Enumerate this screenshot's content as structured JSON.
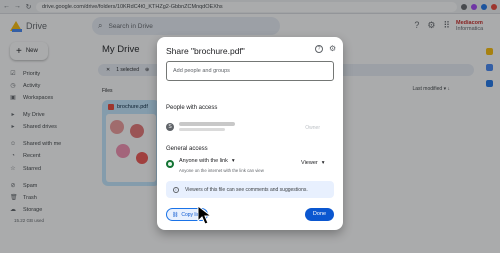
{
  "browser": {
    "url": "drive.google.com/drive/folders/10KRdC4t0_KTHZg2-GbbnZCMnqdOEXhs"
  },
  "header": {
    "app_name": "Drive",
    "search_placeholder": "Search in Drive",
    "brand_lines": [
      "Mediacom",
      "Informatica"
    ]
  },
  "sidebar": {
    "new_label": "New",
    "items": [
      {
        "label": "Priority",
        "icon": "priority-icon"
      },
      {
        "label": "Activity",
        "icon": "activity-icon"
      },
      {
        "label": "Workspaces",
        "icon": "workspaces-icon"
      },
      {
        "label": "My Drive",
        "icon": "my-drive-icon"
      },
      {
        "label": "Shared drives",
        "icon": "shared-drives-icon"
      },
      {
        "label": "Shared with me",
        "icon": "shared-icon"
      },
      {
        "label": "Recent",
        "icon": "clock-icon"
      },
      {
        "label": "Starred",
        "icon": "star-icon"
      },
      {
        "label": "Spam",
        "icon": "spam-icon"
      },
      {
        "label": "Trash",
        "icon": "trash-icon"
      },
      {
        "label": "Storage",
        "icon": "cloud-icon"
      }
    ],
    "storage_used": "15.22 GB used"
  },
  "main": {
    "title": "My Drive",
    "selection": "1 selected",
    "files_label": "Files",
    "sort_label": "Last modified",
    "file_name": "brochure.pdf"
  },
  "dialog": {
    "title": "Share \"brochure.pdf\"",
    "add_people_placeholder": "Add people and groups",
    "people_heading": "People with access",
    "owner_avatar_letter": "S",
    "owner_role": "Owner",
    "general_access_heading": "General access",
    "access_option": "Anyone with the link",
    "access_description": "Anyone on the internet with the link can view",
    "role": "Viewer",
    "info_text": "Viewers of this file can see comments and suggestions.",
    "copy_link_label": "Copy link",
    "done_label": "Done"
  },
  "colors": {
    "primary_blue": "#0b57d0",
    "selection_blue": "#c2e7ff",
    "info_bg": "#e8f0fe",
    "link_green": "#137333"
  }
}
